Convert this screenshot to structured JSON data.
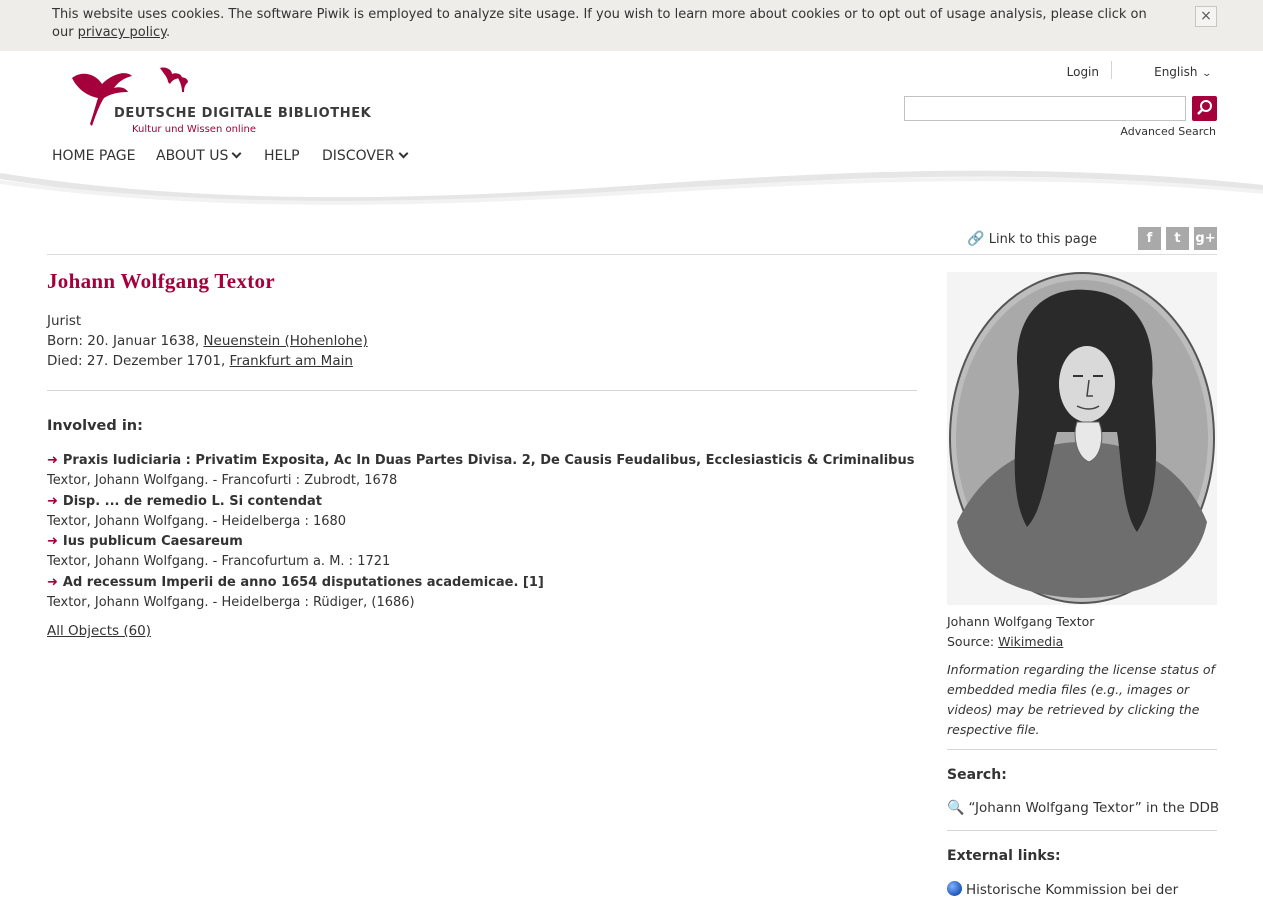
{
  "cookie_banner": {
    "text": "This website uses cookies. The software Piwik is employed to analyze site usage. If you wish to learn more about cookies or to opt out of usage analysis, please click on our ",
    "link": "privacy policy",
    "end": ".",
    "close": "×"
  },
  "logo": {
    "name": "DEUTSCHE DIGITALE BIBLIOTHEK",
    "tagline": "Kultur und Wissen online"
  },
  "header": {
    "login": "Login",
    "language": "English",
    "search_value": "",
    "advanced_search": "Advanced Search"
  },
  "nav": [
    {
      "label": "HOME PAGE"
    },
    {
      "label": "ABOUT US"
    },
    {
      "label": "HELP"
    },
    {
      "label": "DISCOVER"
    }
  ],
  "toolbar": {
    "permalink": "Link to this page",
    "social": [
      "f",
      "t",
      "g+"
    ]
  },
  "person": {
    "name": "Johann Wolfgang Textor",
    "profession": "Jurist",
    "born_label": "Born: 20. Januar 1638, ",
    "born_place": "Neuenstein (Hohenlohe)",
    "died_label": "Died: 27. Dezember 1701, ",
    "died_place": "Frankfurt am Main"
  },
  "involved": {
    "title": "Involved in:",
    "items": [
      {
        "title": "Praxis Iudiciaria : Privatim Exposita, Ac In Duas Partes Divisa. 2, De Causis Feudalibus, Ecclesiasticis & Criminalibus",
        "meta": "Textor, Johann Wolfgang. - Francofurti : Zubrodt, 1678"
      },
      {
        "title": "Disp. ... de remedio L. Si contendat",
        "meta": "Textor, Johann Wolfgang. - Heidelberga : 1680"
      },
      {
        "title": "Ius publicum Caesareum",
        "meta": "Textor, Johann Wolfgang. - Francofurtum a. M. : 1721"
      },
      {
        "title": "Ad recessum Imperii de anno 1654 disputationes academicae. [1]",
        "meta": "Textor, Johann Wolfgang. - Heidelberga : Rüdiger, (1686)"
      }
    ],
    "all_objects": "All Objects (60)"
  },
  "sidebar": {
    "caption": "Johann Wolfgang Textor",
    "source_label": "Source: ",
    "source_link": "Wikimedia",
    "license": "Information regarding the license status of embedded media files (e.g., images or videos) may be retrieved by clicking the respective file.",
    "search_title": "Search:",
    "search_link": "“Johann Wolfgang Textor” in the DDB",
    "external_title": "External links:",
    "external_link": "Historische Kommission bei der"
  },
  "colors": {
    "accent": "#a5003b",
    "banner": "#efedea"
  }
}
